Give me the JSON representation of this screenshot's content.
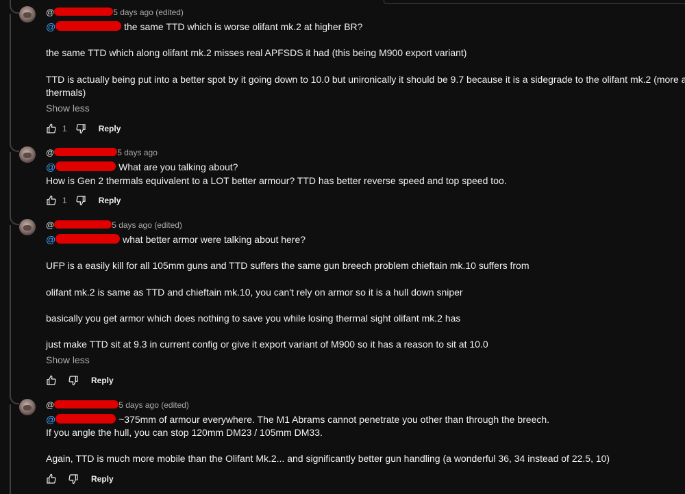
{
  "comments": [
    {
      "meta": "5 days ago (edited)",
      "at": "@",
      "lines": [
        "the same TTD which is worse olifant mk.2 at higher BR?",
        "the same TTD which along olifant mk.2 misses real APFSDS it had (this being M900 export variant)",
        "TTD is actually being put into a better spot by it going down to 10.0 but unironically it should be 9.7 because it is a sidegrade to the olifant mk.2 (more armor b",
        "thermals)"
      ],
      "show_less": "Show less",
      "likes": "1",
      "reply": "Reply"
    },
    {
      "meta": "5 days ago",
      "at": "@",
      "lines": [
        "What are you talking about?",
        "How is Gen 2 thermals equivalent to a LOT better armour? TTD has better reverse speed and top speed too."
      ],
      "likes": "1",
      "reply": "Reply"
    },
    {
      "meta": "5 days ago (edited)",
      "at": "@",
      "lines": [
        "what better armor were talking about here?",
        "UFP is a easily kill for all 105mm guns and TTD suffers the same gun breech problem chieftain mk.10 suffers from",
        "olifant mk.2 is same as TTD and chieftain mk.10, you can't rely on armor so it is a hull down sniper",
        "basically you get armor which does nothing to save you while losing thermal sight olifant mk.2 has",
        "just make TTD sit at 9.3 in current config or give it export variant of M900 so it has a reason to sit at 10.0"
      ],
      "show_less": "Show less",
      "reply": "Reply"
    },
    {
      "meta": "5 days ago (edited)",
      "at": "@",
      "lines": [
        "~375mm of armour everywhere. The M1 Abrams cannot penetrate you other than through the breech.",
        "If you angle the hull, you can stop 120mm DM23 / 105mm DM33.",
        "Again, TTD is much more mobile than the Olifant Mk.2... and significantly better gun handling (a wonderful 36, 34 instead of 22.5, 10)"
      ],
      "reply": "Reply"
    }
  ],
  "colors": {
    "background": "#0f0f0f",
    "text": "#f1f1f1",
    "muted": "#aaaaaa",
    "mention": "#3ea6ff",
    "redaction": "#e00000"
  }
}
